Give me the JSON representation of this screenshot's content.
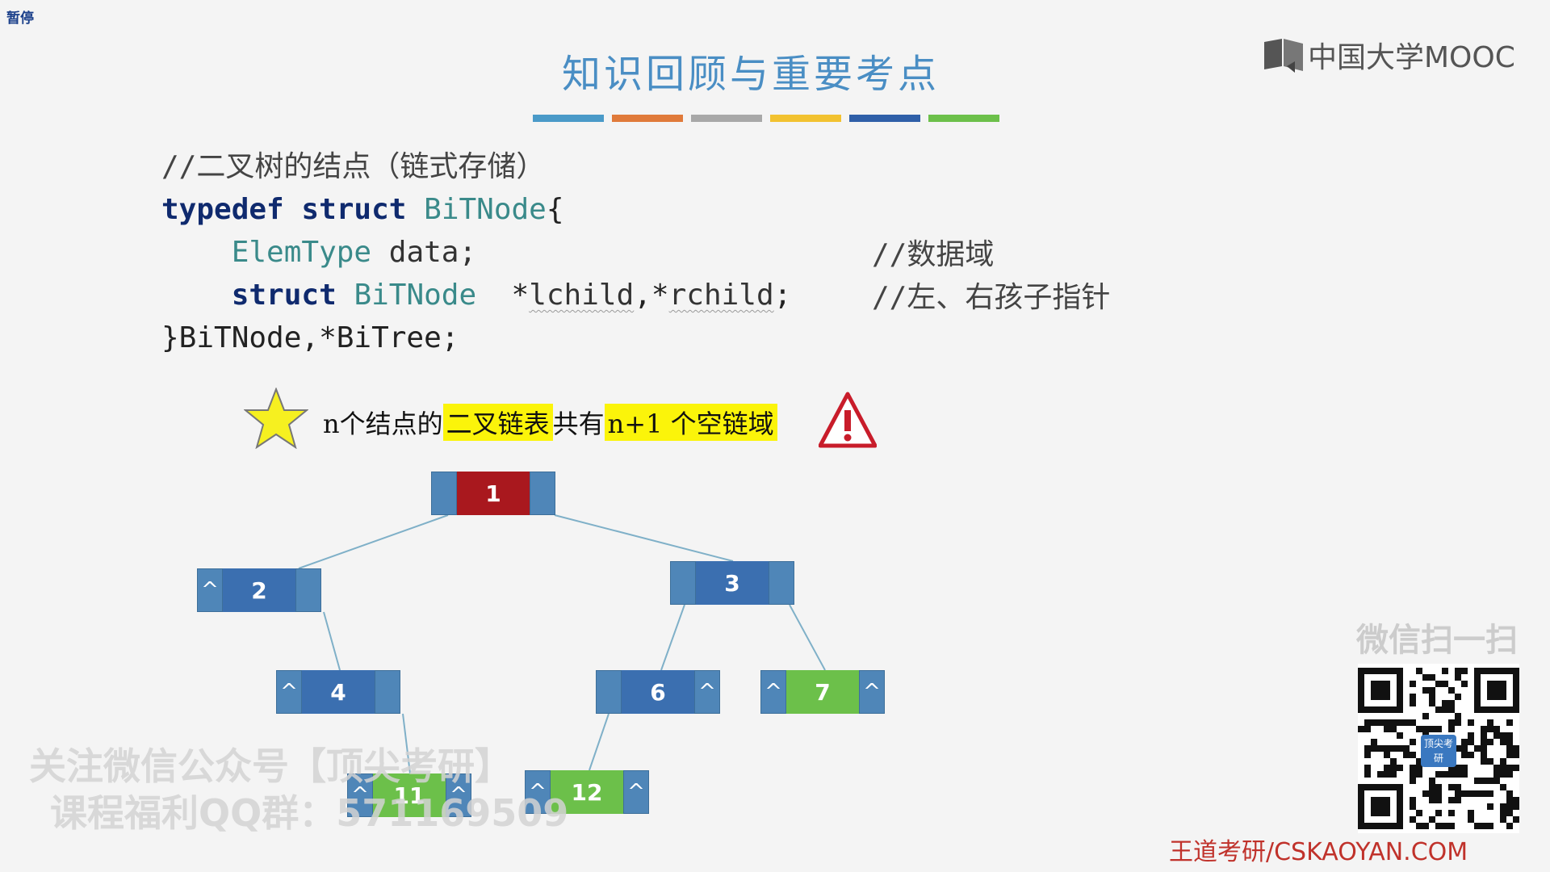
{
  "player": {
    "pause_label": "暂停"
  },
  "slide": {
    "title": "知识回顾与重要考点",
    "colorbar": [
      "#4a9ac8",
      "#e07a3a",
      "#a8a8a8",
      "#f2c230",
      "#2f5fa8",
      "#6cc04a"
    ],
    "logo_text": "中国大学MOOC",
    "code": {
      "line1": "//二叉树的结点（链式存储）",
      "kw_typedef": "typedef",
      "kw_struct": "struct",
      "type_bitnode": "BiTNode",
      "brace_open": "{",
      "type_elem": "ElemType",
      "field_data": "data;",
      "comment_data": "//数据域",
      "ptr_pre": "*",
      "field_lchild": "lchild",
      "ptr_mid": ",*",
      "field_rchild": "rchild",
      "semi": ";",
      "comment_ptr": "//左、右孩子指针",
      "close_line": "}BiTNode,*BiTree;"
    },
    "note": {
      "part1": "n个结点的",
      "hl1": "二叉链表",
      "part2": "共有",
      "hl2": "n+1 个空链域"
    },
    "tree": {
      "nodes": [
        {
          "id": "1",
          "label": "1",
          "left": "",
          "right": "",
          "color": "#a9181e"
        },
        {
          "id": "2",
          "label": "2",
          "left": "^",
          "right": "",
          "color": "#3b6fb0"
        },
        {
          "id": "3",
          "label": "3",
          "left": "",
          "right": "",
          "color": "#3b6fb0"
        },
        {
          "id": "4",
          "label": "4",
          "left": "^",
          "right": "",
          "color": "#3b6fb0"
        },
        {
          "id": "6",
          "label": "6",
          "left": "",
          "right": "^",
          "color": "#3b6fb0"
        },
        {
          "id": "7",
          "label": "7",
          "left": "^",
          "right": "^",
          "color": "#6cc04a"
        },
        {
          "id": "11",
          "label": "11",
          "left": "^",
          "right": "^",
          "color": "#6cc04a"
        },
        {
          "id": "12",
          "label": "12",
          "left": "^",
          "right": "^",
          "color": "#6cc04a"
        }
      ]
    },
    "watermark": {
      "line1": "关注微信公众号【顶尖考研】",
      "line2": "课程福利QQ群：571169509"
    },
    "wechat_scan": "微信扫一扫",
    "qr_badge": "顶尖考研",
    "footer": "王道考研/CSKAOYAN.COM"
  }
}
